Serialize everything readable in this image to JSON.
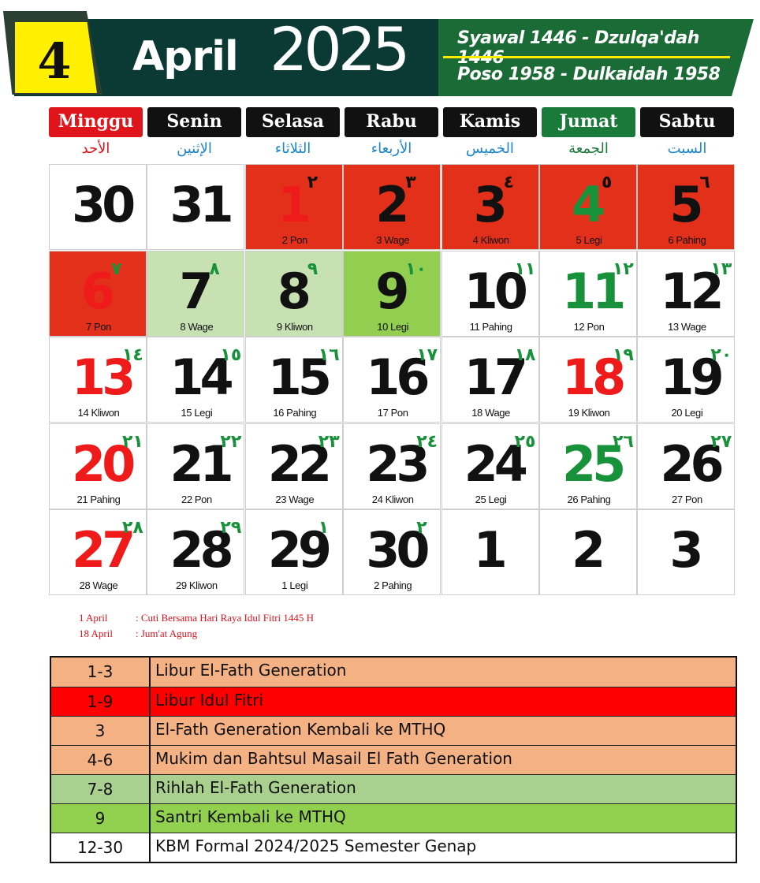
{
  "header": {
    "month_number": "4",
    "month_name": "April",
    "year": "2025",
    "hijri": "Syawal 1446 - Dzulqa'dah 1446",
    "jawa": "Poso 1958 - Dulkaidah 1958"
  },
  "colors": {
    "header_dark": "#0b3a34",
    "header_green": "#1a6b35",
    "yellow": "#ffef00",
    "holiday_red": "#e3301a",
    "light_green": "#c7e1b2",
    "green": "#92cf50",
    "schedule_peach": "#f4b183",
    "schedule_red": "#ff0000",
    "schedule_lgreen": "#a9d08e",
    "schedule_green": "#92d050"
  },
  "weekdays": [
    {
      "name": "Minggu",
      "arabic": "الأحد",
      "style": "red"
    },
    {
      "name": "Senin",
      "arabic": "الإثنين",
      "style": "black"
    },
    {
      "name": "Selasa",
      "arabic": "الثلاثاء",
      "style": "black"
    },
    {
      "name": "Rabu",
      "arabic": "الأربعاء",
      "style": "black"
    },
    {
      "name": "Kamis",
      "arabic": "الخميس",
      "style": "black"
    },
    {
      "name": "Jumat",
      "arabic": "الجمعة",
      "style": "green"
    },
    {
      "name": "Sabtu",
      "arabic": "السبت",
      "style": "black"
    }
  ],
  "weeks": [
    [
      {
        "day": "30",
        "hijri": "",
        "pasaran": "",
        "color": "black",
        "bg": ""
      },
      {
        "day": "31",
        "hijri": "",
        "pasaran": "",
        "color": "black",
        "bg": ""
      },
      {
        "day": "1",
        "hijri": "٢",
        "pasaran": "2 Pon",
        "color": "red",
        "bg": "red"
      },
      {
        "day": "2",
        "hijri": "٣",
        "pasaran": "3 Wage",
        "color": "black",
        "bg": "red"
      },
      {
        "day": "3",
        "hijri": "٤",
        "pasaran": "4 Kliwon",
        "color": "black",
        "bg": "red"
      },
      {
        "day": "4",
        "hijri": "٥",
        "pasaran": "5 Legi",
        "color": "green",
        "bg": "red"
      },
      {
        "day": "5",
        "hijri": "٦",
        "pasaran": "6 Pahing",
        "color": "black",
        "bg": "red"
      }
    ],
    [
      {
        "day": "6",
        "hijri": "٧",
        "pasaran": "7 Pon",
        "color": "red",
        "bg": "red"
      },
      {
        "day": "7",
        "hijri": "٨",
        "pasaran": "8 Wage",
        "color": "black",
        "bg": "lgreen"
      },
      {
        "day": "8",
        "hijri": "٩",
        "pasaran": "9 Kliwon",
        "color": "black",
        "bg": "lgreen"
      },
      {
        "day": "9",
        "hijri": "١٠",
        "pasaran": "10  Legi",
        "color": "black",
        "bg": "green"
      },
      {
        "day": "10",
        "hijri": "١١",
        "pasaran": "11 Pahing",
        "color": "black",
        "bg": ""
      },
      {
        "day": "11",
        "hijri": "١٢",
        "pasaran": "12 Pon",
        "color": "green",
        "bg": ""
      },
      {
        "day": "12",
        "hijri": "١٣",
        "pasaran": "13 Wage",
        "color": "black",
        "bg": ""
      }
    ],
    [
      {
        "day": "13",
        "hijri": "١٤",
        "pasaran": "14 Kliwon",
        "color": "red",
        "bg": ""
      },
      {
        "day": "14",
        "hijri": "١٥",
        "pasaran": "15 Legi",
        "color": "black",
        "bg": ""
      },
      {
        "day": "15",
        "hijri": "١٦",
        "pasaran": "16 Pahing",
        "color": "black",
        "bg": ""
      },
      {
        "day": "16",
        "hijri": "١٧",
        "pasaran": "17 Pon",
        "color": "black",
        "bg": ""
      },
      {
        "day": "17",
        "hijri": "١٨",
        "pasaran": "18 Wage",
        "color": "black",
        "bg": ""
      },
      {
        "day": "18",
        "hijri": "١٩",
        "pasaran": "19 Kliwon",
        "color": "red",
        "bg": ""
      },
      {
        "day": "19",
        "hijri": "٢٠",
        "pasaran": "20 Legi",
        "color": "black",
        "bg": ""
      }
    ],
    [
      {
        "day": "20",
        "hijri": "٢١",
        "pasaran": "21 Pahing",
        "color": "red",
        "bg": ""
      },
      {
        "day": "21",
        "hijri": "٢٢",
        "pasaran": "22 Pon",
        "color": "black",
        "bg": ""
      },
      {
        "day": "22",
        "hijri": "٢٣",
        "pasaran": "23 Wage",
        "color": "black",
        "bg": ""
      },
      {
        "day": "23",
        "hijri": "٢٤",
        "pasaran": "24 Kliwon",
        "color": "black",
        "bg": ""
      },
      {
        "day": "24",
        "hijri": "٢٥",
        "pasaran": "25 Legi",
        "color": "black",
        "bg": ""
      },
      {
        "day": "25",
        "hijri": "٢٦",
        "pasaran": "26 Pahing",
        "color": "green",
        "bg": ""
      },
      {
        "day": "26",
        "hijri": "٢٧",
        "pasaran": "27 Pon",
        "color": "black",
        "bg": ""
      }
    ],
    [
      {
        "day": "27",
        "hijri": "٢٨",
        "pasaran": "28 Wage",
        "color": "red",
        "bg": ""
      },
      {
        "day": "28",
        "hijri": "٢٩",
        "pasaran": "29 Kliwon",
        "color": "black",
        "bg": ""
      },
      {
        "day": "29",
        "hijri": "١",
        "pasaran": "1 Legi",
        "color": "black",
        "bg": ""
      },
      {
        "day": "30",
        "hijri": "٢",
        "pasaran": "2 Pahing",
        "color": "black",
        "bg": ""
      },
      {
        "day": "1",
        "hijri": "",
        "pasaran": "",
        "color": "black",
        "bg": ""
      },
      {
        "day": "2",
        "hijri": "",
        "pasaran": "",
        "color": "black",
        "bg": ""
      },
      {
        "day": "3",
        "hijri": "",
        "pasaran": "",
        "color": "black",
        "bg": ""
      }
    ]
  ],
  "notes": [
    {
      "date": "1 April",
      "text": ": Cuti Bersama Hari Raya Idul Fitri 1445 H"
    },
    {
      "date": "18 April",
      "text": ": Jum'at Agung"
    }
  ],
  "schedule": [
    {
      "dates": "1-3",
      "text": "Libur El-Fath Generation",
      "color": "#f4b183"
    },
    {
      "dates": "1-9",
      "text": "Libur Idul Fitri",
      "color": "#ff0000"
    },
    {
      "dates": "3",
      "text": "El-Fath Generation Kembali ke MTHQ",
      "color": "#f4b183"
    },
    {
      "dates": "4-6",
      "text": "Mukim dan Bahtsul Masail El Fath Generation",
      "color": "#f4b183"
    },
    {
      "dates": "7-8",
      "text": "Rihlah El-Fath Generation",
      "color": "#a9d08e"
    },
    {
      "dates": "9",
      "text": "Santri Kembali ke MTHQ",
      "color": "#92d050"
    },
    {
      "dates": "12-30",
      "text": "KBM Formal 2024/2025 Semester Genap",
      "color": "#ffffff"
    }
  ]
}
